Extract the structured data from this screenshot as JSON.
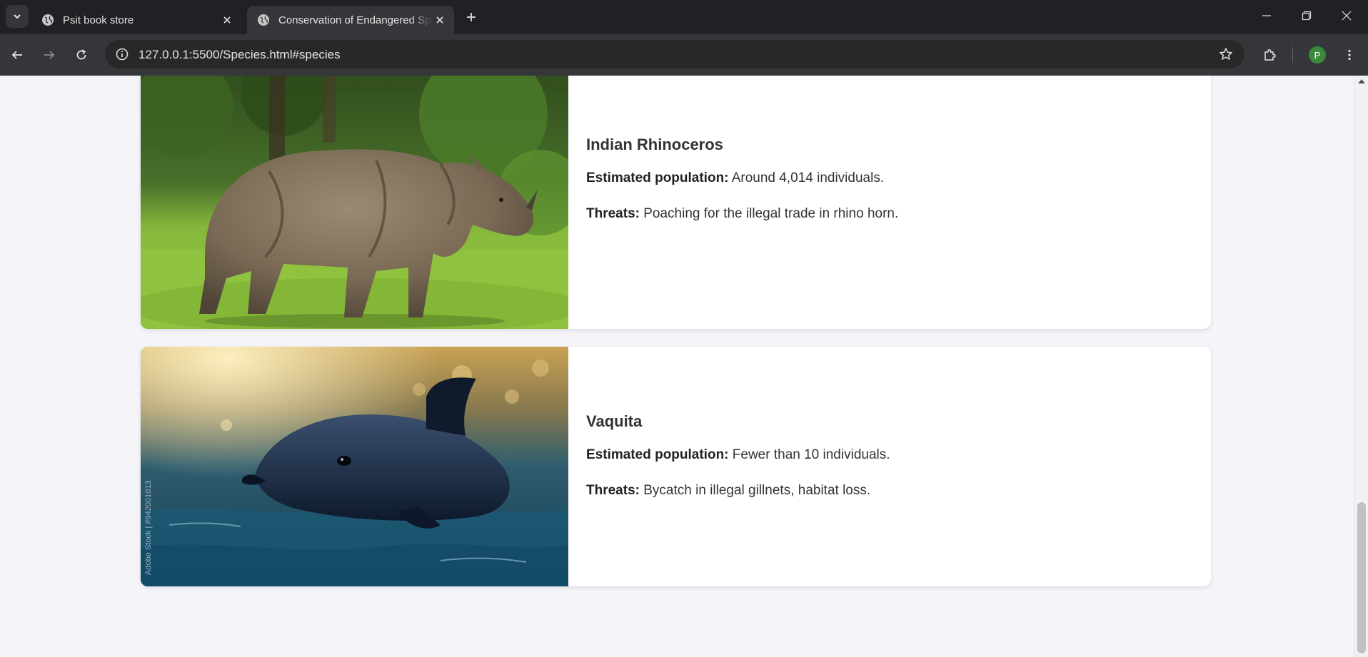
{
  "browser": {
    "tabs": [
      {
        "title": "Psit book store",
        "active": false
      },
      {
        "title": "Conservation of Endangered Species",
        "active": true
      }
    ],
    "url": "127.0.0.1:5500/Species.html#species",
    "profile_initial": "P"
  },
  "species": [
    {
      "name": "Indian Rhinoceros",
      "population_label": "Estimated population:",
      "population_value": "Around 4,014 individuals.",
      "threats_label": "Threats:",
      "threats_value": "Poaching for the illegal trade in rhino horn."
    },
    {
      "name": "Vaquita",
      "population_label": "Estimated population:",
      "population_value": "Fewer than 10 individuals.",
      "threats_label": "Threats:",
      "threats_value": "Bycatch in illegal gillnets, habitat loss.",
      "image_watermark": "Adobe Stock | #942001013"
    }
  ],
  "colors": {
    "chrome_frame": "#202124",
    "chrome_toolbar": "#35363a",
    "page_background": "#f4f4f9",
    "card_background": "#ffffff",
    "text": "#333333"
  }
}
